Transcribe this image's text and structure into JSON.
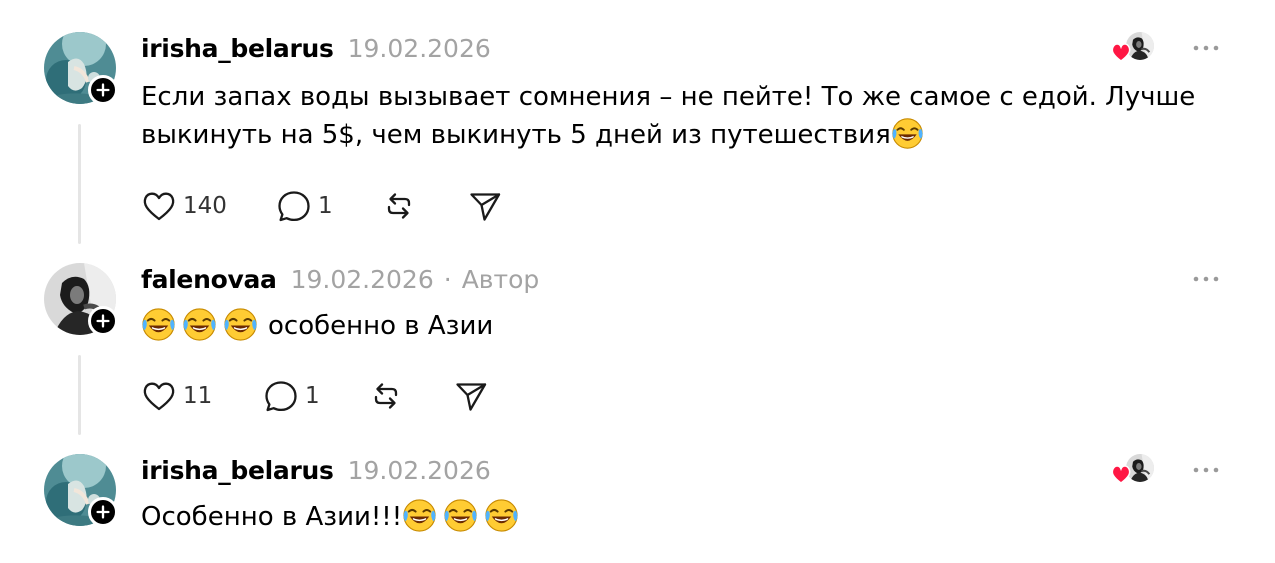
{
  "posts": [
    {
      "username": "irisha_belarus",
      "date": "19.02.2026",
      "text_lines": [
        "Если запах воды вызывает сомнения – не пейте! То же самое с едой. Лучше",
        "выкинуть на 5$, чем выкинуть 5 дней из путешествия"
      ],
      "likes": "140",
      "replies": "1"
    },
    {
      "username": "falenovaa",
      "date": "19.02.2026",
      "separator": "·",
      "author_badge": "Автор",
      "text": "особенно в Азии",
      "likes": "11",
      "replies": "1"
    },
    {
      "username": "irisha_belarus",
      "date": "19.02.2026",
      "text": "Особенно в Азии!!!"
    }
  ],
  "icons": {
    "avatar_1": "avatar-underwater-photo",
    "avatar_2": "avatar-bw-portrait",
    "follow": "plus-icon",
    "like": "heart-outline-icon",
    "reply": "speech-bubble-icon",
    "repost": "repost-icon",
    "share": "send-icon",
    "more": "more-dots-icon",
    "liked_by_author": "red-heart-icon",
    "emoji": "face-with-tears-of-joy-emoji"
  },
  "colors": {
    "text": "#000000",
    "muted": "#a3a3a3",
    "thread_line": "#e5e5e5",
    "heart": "#ff1744"
  }
}
